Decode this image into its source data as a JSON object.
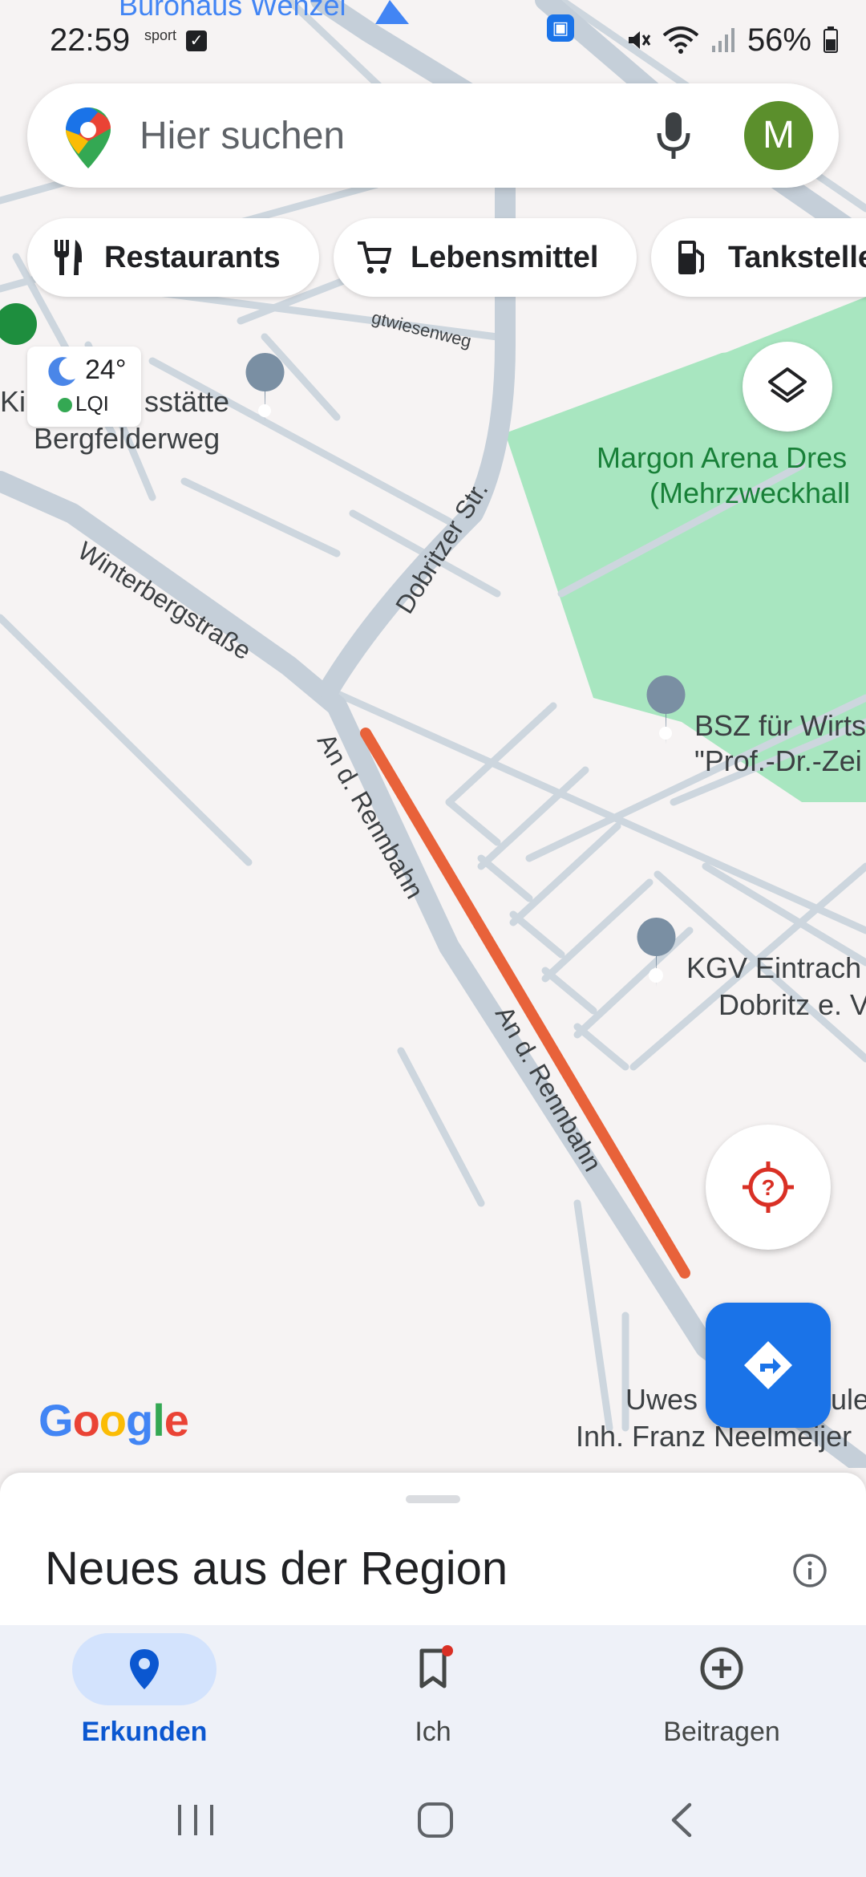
{
  "status_bar": {
    "time": "22:59",
    "small_label": "sport",
    "battery": "56%"
  },
  "search": {
    "placeholder": "Hier suchen",
    "avatar_letter": "M"
  },
  "chips": [
    {
      "label": "Restaurants",
      "icon": "fork-knife-icon"
    },
    {
      "label": "Lebensmittel",
      "icon": "cart-icon"
    },
    {
      "label": "Tankstelle",
      "icon": "fuel-icon"
    }
  ],
  "weather": {
    "temperature": "24°",
    "aqi_label": "LQI"
  },
  "map_labels": {
    "top_poi": "Bürohaus Wenzel",
    "school_1a": "Kin",
    "school_1b": "sstätte",
    "school_1c": "Bergfelderweg",
    "street_small": "gtwiesenweg",
    "arena_1": "Margon Arena Dres",
    "arena_2": "(Mehrzweckhall",
    "street_dobritzer": "Dobritzer Str.",
    "street_winterberg": "Winterbergstraße",
    "street_rennbahn_1": "An d. Rennbahn",
    "street_rennbahn_2": "An d. Rennbahn",
    "bsz_1": "BSZ für Wirts",
    "bsz_2": "\"Prof.-Dr.-Zei",
    "kgv_1": "KGV Eintrach",
    "kgv_2": "Dobritz e. V",
    "uwes_1": "Uwes",
    "uwes_2": "ule,",
    "uwes_3": "Inh. Franz Neelmeijer"
  },
  "logo": {
    "letters": [
      "G",
      "o",
      "o",
      "g",
      "l",
      "e"
    ],
    "colors": [
      "#4285f4",
      "#ea4335",
      "#fbbc05",
      "#4285f4",
      "#34a853",
      "#ea4335"
    ]
  },
  "sheet": {
    "title": "Neues aus der Region"
  },
  "bottom_nav": [
    {
      "label": "Erkunden",
      "icon": "explore-pin-icon",
      "active": true
    },
    {
      "label": "Ich",
      "icon": "bookmark-icon",
      "active": false
    },
    {
      "label": "Beitragen",
      "icon": "add-circle-icon",
      "active": false
    }
  ],
  "colors": {
    "route": "#e8623a",
    "park": "#a8e6c0",
    "road": "#c9d3dc",
    "accent": "#1a73e8"
  }
}
